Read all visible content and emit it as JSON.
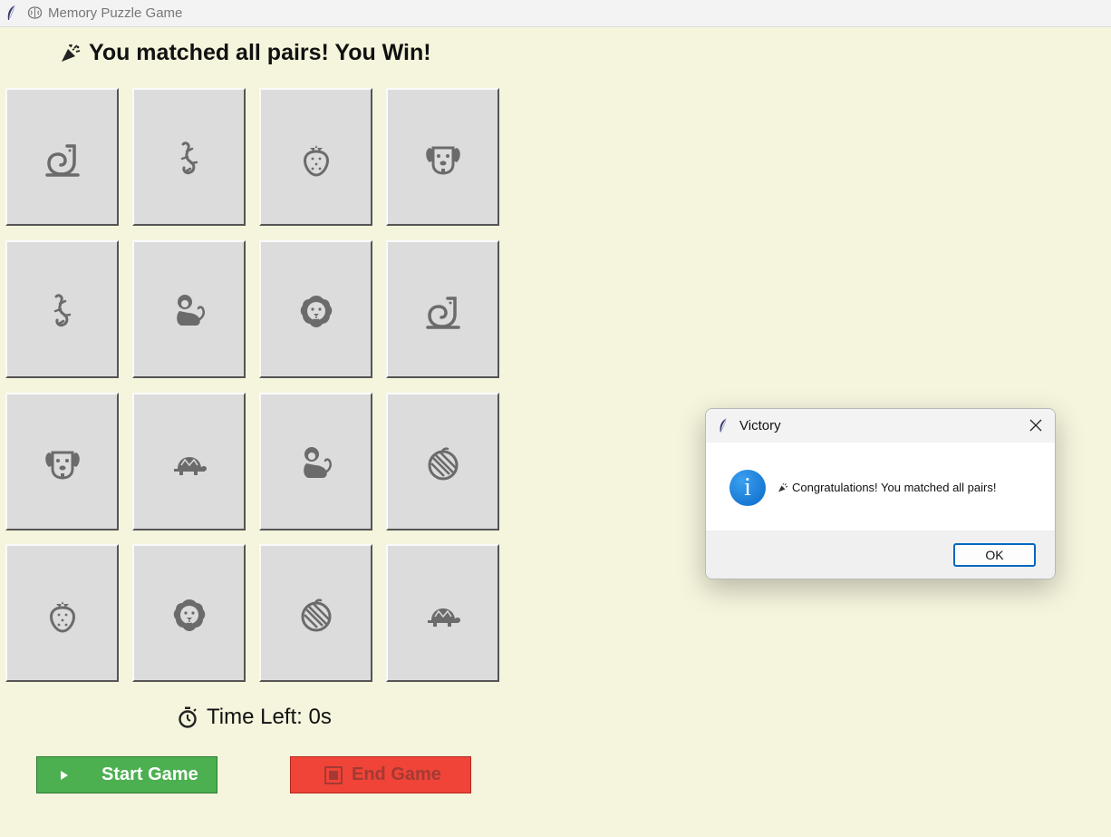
{
  "window": {
    "title": "Memory Puzzle Game"
  },
  "status": {
    "message": "You matched all pairs! You Win!"
  },
  "cards": [
    {
      "icon": "snake-icon"
    },
    {
      "icon": "lizard-icon"
    },
    {
      "icon": "strawberry-icon"
    },
    {
      "icon": "dog-icon"
    },
    {
      "icon": "lizard-icon"
    },
    {
      "icon": "monkey-icon"
    },
    {
      "icon": "lion-icon"
    },
    {
      "icon": "snake-icon"
    },
    {
      "icon": "dog-icon"
    },
    {
      "icon": "turtle-icon"
    },
    {
      "icon": "monkey-icon"
    },
    {
      "icon": "melon-icon"
    },
    {
      "icon": "strawberry-icon"
    },
    {
      "icon": "lion-icon"
    },
    {
      "icon": "melon-icon"
    },
    {
      "icon": "turtle-icon"
    }
  ],
  "timer": {
    "label": "Time Left: 0s"
  },
  "buttons": {
    "start": "Start Game",
    "end": "End Game"
  },
  "dialog": {
    "title": "Victory",
    "message": "Congratulations! You matched all pairs!",
    "ok": "OK"
  },
  "colors": {
    "background": "#f5f4dc",
    "card": "#dcdcdc",
    "start": "#4caf50",
    "end": "#f04438",
    "icon": "#6b6b6b"
  }
}
